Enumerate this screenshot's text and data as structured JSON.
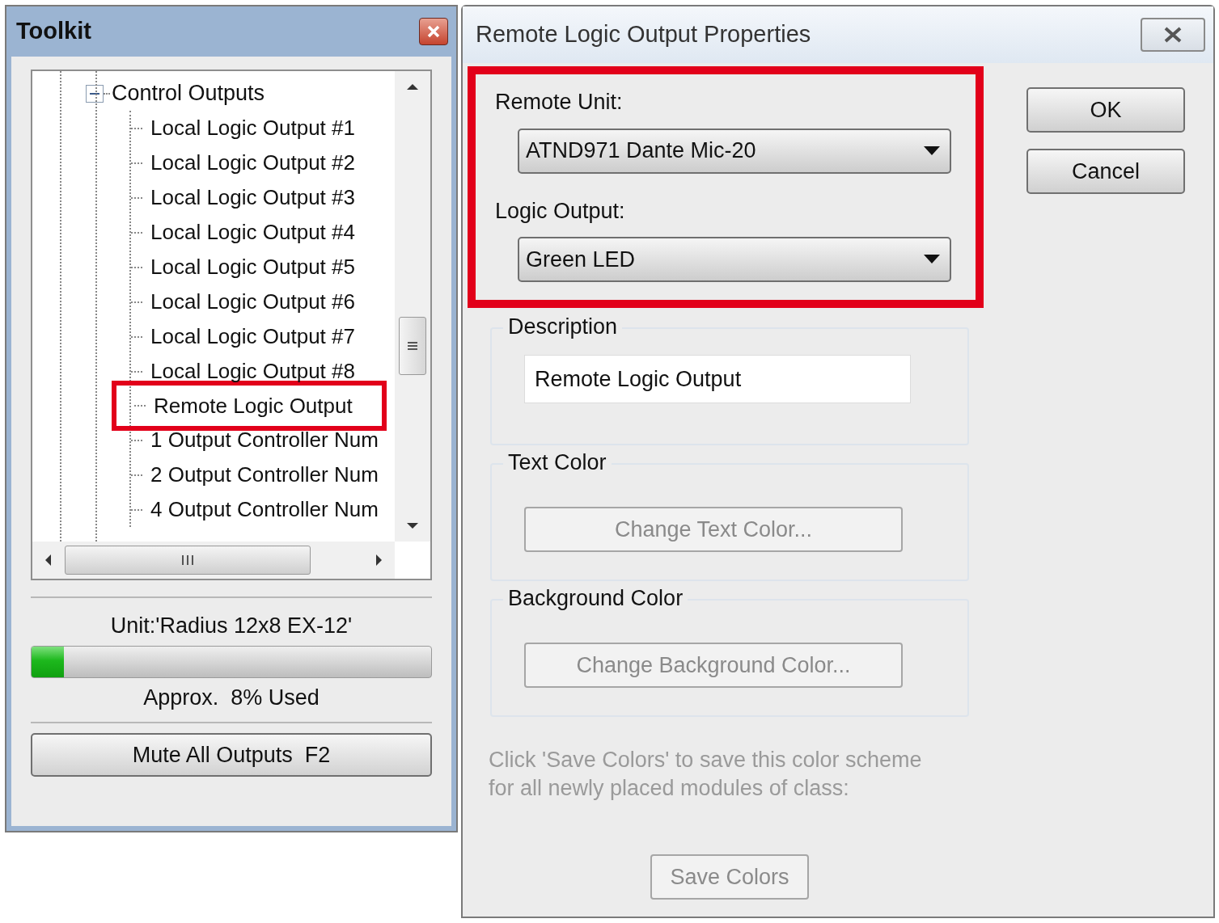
{
  "toolkit": {
    "title": "Toolkit",
    "tree": [
      {
        "label": "Control Outputs",
        "expanded": true,
        "children": [
          {
            "label": "Local Logic Output #1",
            "highlighted": false
          },
          {
            "label": "Local Logic Output #2",
            "highlighted": false
          },
          {
            "label": "Local Logic Output #3",
            "highlighted": false
          },
          {
            "label": "Local Logic Output #4",
            "highlighted": false
          },
          {
            "label": "Local Logic Output #5",
            "highlighted": false
          },
          {
            "label": "Local Logic Output #6",
            "highlighted": false
          },
          {
            "label": "Local Logic Output #7",
            "highlighted": false
          },
          {
            "label": "Local Logic Output #8",
            "highlighted": false
          },
          {
            "label": "Remote Logic Output",
            "highlighted": true
          },
          {
            "label": "1 Output Controller Num",
            "highlighted": false
          },
          {
            "label": "2 Output Controller Num",
            "highlighted": false
          },
          {
            "label": "4 Output Controller Num",
            "highlighted": false
          }
        ]
      }
    ],
    "unit_label": "Unit:'Radius 12x8 EX-12'",
    "usage": {
      "level": 0.08,
      "reading": "Approx.  8% Used"
    },
    "mute_button": "Mute All Outputs  F2"
  },
  "dialog": {
    "title": "Remote Logic Output Properties",
    "remote_section": {
      "highlighted": true,
      "fields": [
        {
          "label": "Remote Unit:",
          "value": "ATND971 Dante Mic-20"
        },
        {
          "label": "Logic Output:",
          "value": "Green LED"
        }
      ]
    },
    "buttons": [
      {
        "label": "OK"
      },
      {
        "label": "Cancel"
      }
    ],
    "groups": [
      {
        "kind": "text",
        "title": "Description",
        "value": "Remote Logic Output"
      },
      {
        "kind": "button",
        "title": "Text Color",
        "button": "Change Text Color...",
        "disabled": true
      },
      {
        "kind": "button",
        "title": "Background Color",
        "button": "Change Background Color...",
        "disabled": true
      }
    ],
    "hint_lines": [
      "Click 'Save Colors' to save this color scheme",
      "for all newly placed modules of class:"
    ],
    "save_button": {
      "label": "Save Colors",
      "disabled": true
    }
  }
}
